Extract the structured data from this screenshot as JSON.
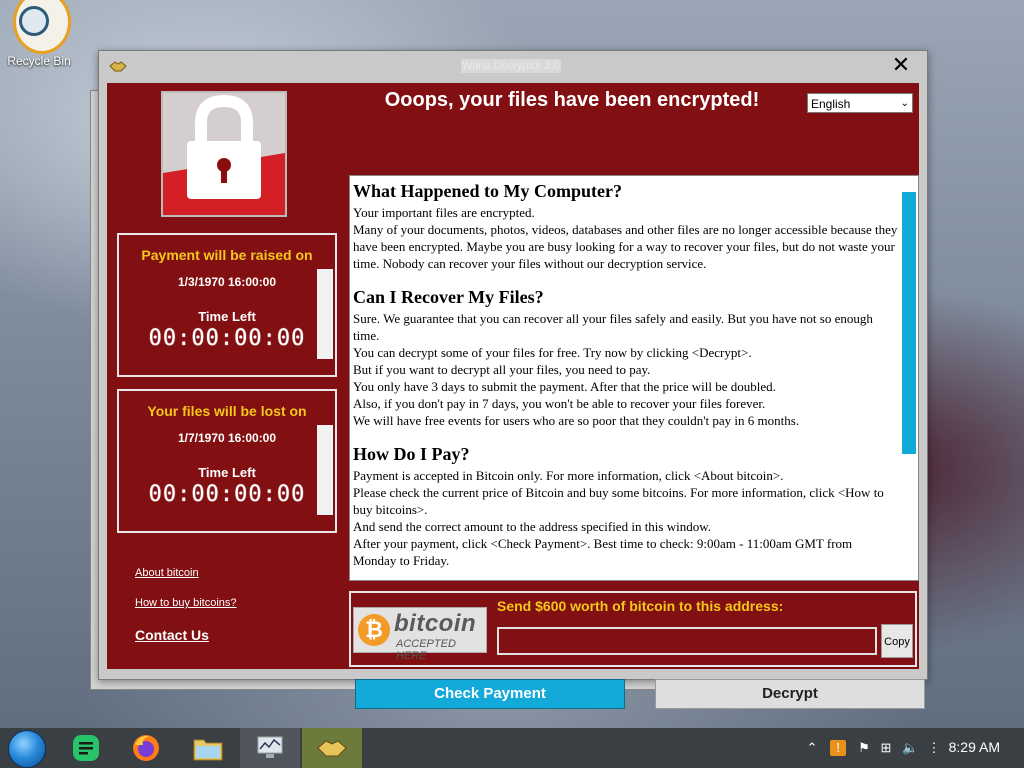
{
  "desktop": {
    "icons": [
      {
        "label": "Recycle Bin"
      }
    ]
  },
  "window": {
    "title": "Wana Decrypt0r 2.0",
    "headline": "Ooops, your files have been encrypted!",
    "language": "English",
    "timers": [
      {
        "heading": "Payment will be raised on",
        "date": "1/3/1970 16:00:00",
        "time_left_label": "Time Left",
        "countdown": "00:00:00:00"
      },
      {
        "heading": "Your files will be lost on",
        "date": "1/7/1970 16:00:00",
        "time_left_label": "Time Left",
        "countdown": "00:00:00:00"
      }
    ],
    "links": {
      "about_bitcoin": "About bitcoin",
      "how_to_buy": "How to buy bitcoins?",
      "contact_us": "Contact Us"
    },
    "text_sections": [
      {
        "heading": "What Happened to My Computer?",
        "lines": [
          "Your important files are encrypted.",
          "Many of your documents, photos, videos, databases and other files are no longer accessible because they have been encrypted. Maybe you are busy looking for a way to recover your files, but do not waste your time. Nobody can recover your files without our decryption service."
        ]
      },
      {
        "heading": "Can I Recover My Files?",
        "lines": [
          "Sure. We guarantee that you can recover all your files safely and easily. But you have not so enough time.",
          "You can decrypt some of your files for free. Try now by clicking <Decrypt>.",
          "But if you want to decrypt all your files, you need to pay.",
          "You only have 3 days to submit the payment. After that the price will be doubled.",
          "Also, if you don't pay in 7 days, you won't be able to recover your files forever.",
          "We will have free events for users who are so poor that they couldn't pay in 6 months."
        ]
      },
      {
        "heading": "How Do I Pay?",
        "lines": [
          "Payment is accepted in Bitcoin only. For more information, click <About bitcoin>.",
          "Please check the current price of Bitcoin and buy some bitcoins. For more information, click <How to buy bitcoins>.",
          "And send the correct amount to the address specified in this window.",
          "After your payment, click <Check Payment>. Best time to check: 9:00am - 11:00am GMT from Monday to Friday."
        ]
      }
    ],
    "payment": {
      "badge_word": "bitcoin",
      "badge_sub": "ACCEPTED HERE",
      "send_label": "Send $600 worth of bitcoin to this address:",
      "address": "",
      "copy_label": "Copy"
    },
    "buttons": {
      "check_payment": "Check Payment",
      "decrypt": "Decrypt"
    }
  },
  "taskbar": {
    "apps": [
      "start-menu",
      "notes-app",
      "firefox",
      "file-manager",
      "system-monitor",
      "wannacry"
    ],
    "clock": "8:29 AM"
  },
  "colors": {
    "panel_red": "#820f11",
    "accent_yellow": "#f3c81a",
    "check_blue": "#13a9d9"
  }
}
